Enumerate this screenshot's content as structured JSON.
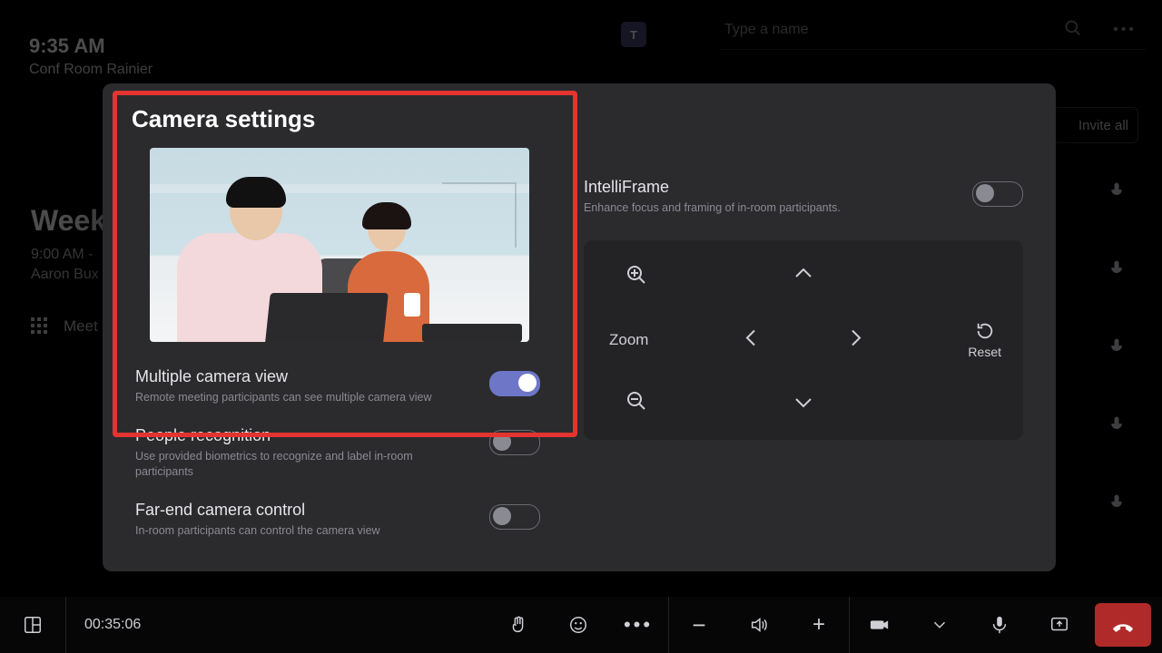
{
  "header": {
    "time": "9:35 AM",
    "room": "Conf Room Rainier",
    "search_placeholder": "Type a name",
    "invite_label": "Invite all",
    "teams_logo_letter": "T"
  },
  "background_meeting": {
    "title": "Weekly",
    "time_range": "9:00 AM -",
    "organizer": "Aaron Bux",
    "meet_now_label": "Meet"
  },
  "modal": {
    "title": "Camera settings",
    "left_settings": [
      {
        "title": "Multiple camera view",
        "desc": "Remote meeting participants can see multiple camera view",
        "on": true
      },
      {
        "title": "People recognition",
        "desc": "Use provided biometrics to recognize and label in-room participants",
        "on": false
      },
      {
        "title": "Far-end camera control",
        "desc": "In-room participants can control the camera view",
        "on": false
      }
    ],
    "right": {
      "intelli_title": "IntelliFrame",
      "intelli_desc": "Enhance focus and framing of in-room participants.",
      "intelli_on": false,
      "zoom_label": "Zoom",
      "reset_label": "Reset"
    }
  },
  "bottom_bar": {
    "call_timer": "00:35:06"
  }
}
